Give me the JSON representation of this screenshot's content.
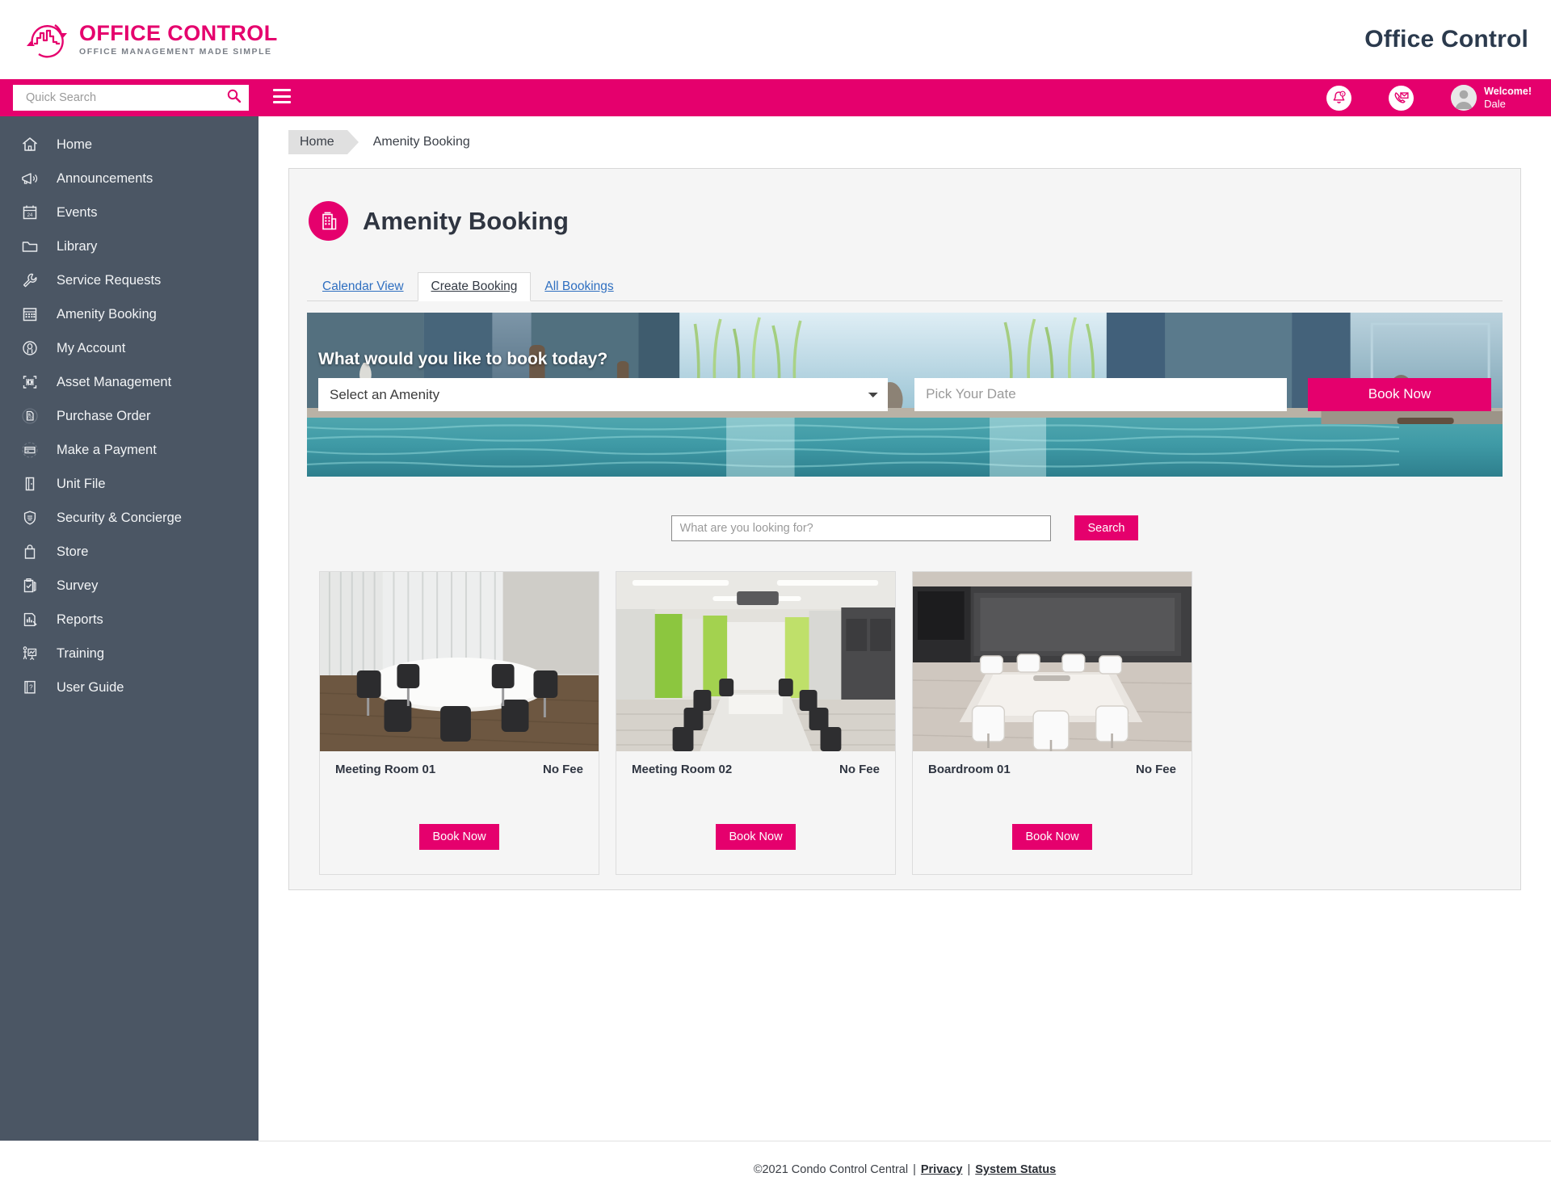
{
  "header": {
    "logo_title": "OFFICE CONTROL",
    "logo_tagline": "OFFICE MANAGEMENT MADE SIMPLE",
    "app_name": "Office Control"
  },
  "topbar": {
    "quick_search_placeholder": "Quick Search",
    "quick_search_value": "",
    "notification_count": "",
    "welcome_label": "Welcome!",
    "user_name": "Dale"
  },
  "sidebar": {
    "items": [
      {
        "label": "Home",
        "icon": "home-icon"
      },
      {
        "label": "Announcements",
        "icon": "megaphone-icon"
      },
      {
        "label": "Events",
        "icon": "calendar-icon"
      },
      {
        "label": "Library",
        "icon": "folder-icon"
      },
      {
        "label": "Service Requests",
        "icon": "wrench-icon"
      },
      {
        "label": "Amenity Booking",
        "icon": "grid-calendar-icon"
      },
      {
        "label": "My Account",
        "icon": "person-circle-icon"
      },
      {
        "label": "Asset Management",
        "icon": "asset-scan-icon"
      },
      {
        "label": "Purchase Order",
        "icon": "purchase-order-icon"
      },
      {
        "label": "Make a Payment",
        "icon": "credit-card-icon"
      },
      {
        "label": "Unit File",
        "icon": "door-icon"
      },
      {
        "label": "Security & Concierge",
        "icon": "shield-icon"
      },
      {
        "label": "Store",
        "icon": "shopping-bag-icon"
      },
      {
        "label": "Survey",
        "icon": "clipboard-check-icon"
      },
      {
        "label": "Reports",
        "icon": "report-chart-icon"
      },
      {
        "label": "Training",
        "icon": "training-board-icon"
      },
      {
        "label": "User Guide",
        "icon": "book-question-icon"
      }
    ]
  },
  "breadcrumb": {
    "home": "Home",
    "current": "Amenity Booking"
  },
  "page": {
    "title": "Amenity Booking",
    "icon": "building-icon"
  },
  "tabs": [
    {
      "label": "Calendar View",
      "active": false
    },
    {
      "label": "Create Booking",
      "active": true
    },
    {
      "label": "All Bookings",
      "active": false
    }
  ],
  "hero": {
    "question": "What would you like to book today?",
    "amenity_select_value": "Select an Amenity",
    "date_placeholder": "Pick Your Date",
    "date_value": "",
    "book_button": "Book Now"
  },
  "search": {
    "placeholder": "What are you looking for?",
    "value": "",
    "button": "Search"
  },
  "amenities": [
    {
      "name": "Meeting Room 01",
      "fee": "No Fee",
      "book_button": "Book Now"
    },
    {
      "name": "Meeting Room 02",
      "fee": "No Fee",
      "book_button": "Book Now"
    },
    {
      "name": "Boardroom 01",
      "fee": "No Fee",
      "book_button": "Book Now"
    }
  ],
  "footer": {
    "copyright": "©2021 Condo Control Central",
    "sep1": "|",
    "privacy": "Privacy",
    "sep2": "|",
    "system_status": "System Status"
  },
  "colors": {
    "brand_pink": "#e5006d",
    "sidebar_bg": "#4b5664",
    "link_blue": "#2f6fc0"
  }
}
